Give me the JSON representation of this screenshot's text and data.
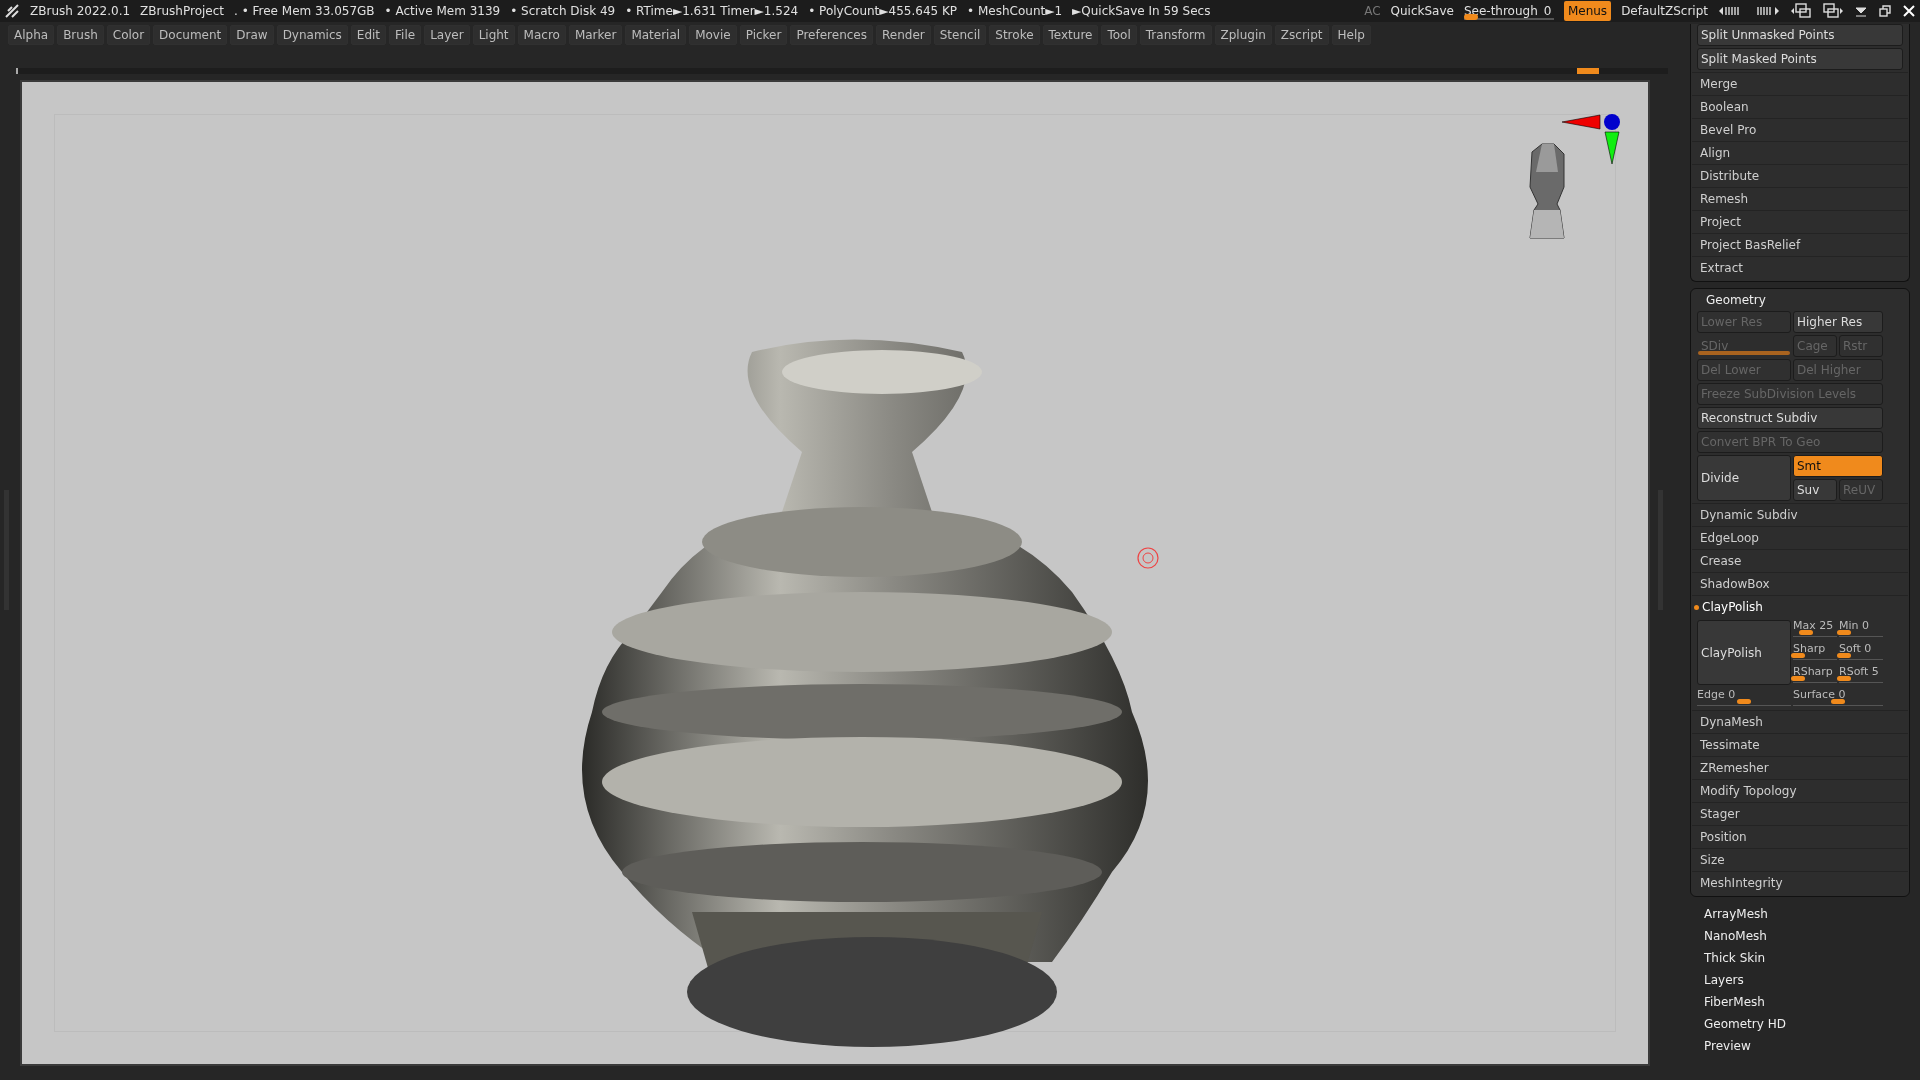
{
  "title_bar": {
    "app": "ZBrush 2022.0.1",
    "project": "ZBrushProject",
    "stats": [
      ". • Free Mem 33.057GB",
      "• Active Mem 3139",
      "• Scratch Disk 49",
      "•  RTime►1.631 Timer►1.524",
      "• PolyCount►455.645 KP",
      "• MeshCount►1"
    ],
    "quicksave_timer": "►QuickSave In 59 Secs",
    "ac": "AC",
    "quicksave": "QuickSave",
    "see_through": {
      "label": "See-through",
      "value": "0",
      "level": 0.08
    },
    "menus": {
      "label": "Menus",
      "on": true
    },
    "script": "DefaultZScript"
  },
  "menu": [
    "Alpha",
    "Brush",
    "Color",
    "Document",
    "Draw",
    "Dynamics",
    "Edit",
    "File",
    "Layer",
    "Light",
    "Macro",
    "Marker",
    "Material",
    "Movie",
    "Picker",
    "Preferences",
    "Render",
    "Stencil",
    "Stroke",
    "Texture",
    "Tool",
    "Transform",
    "Zplugin",
    "Zscript",
    "Help"
  ],
  "timeline": {
    "level": 0.945
  },
  "subtool_buttons": [
    "Split Unmasked Points",
    "Split Masked Points"
  ],
  "subtool_items": [
    "Merge",
    "Boolean",
    "Bevel Pro",
    "Align",
    "Distribute",
    "Remesh",
    "Project",
    "Project BasRelief",
    "Extract"
  ],
  "geometry": {
    "title": "Geometry",
    "grid": [
      {
        "kind": "pair",
        "cells": [
          {
            "label": "Lower Res",
            "disabled": true
          },
          {
            "label": "Higher Res",
            "disabled": false
          }
        ]
      },
      {
        "kind": "sdiv",
        "cells": [
          {
            "label": "SDiv",
            "disabled": true,
            "level": 1
          },
          {
            "label": "Cage",
            "disabled": true
          },
          {
            "label": "Rstr",
            "disabled": true
          }
        ]
      },
      {
        "kind": "pair",
        "cells": [
          {
            "label": "Del Lower",
            "disabled": true
          },
          {
            "label": "Del Higher",
            "disabled": true
          }
        ]
      },
      {
        "kind": "wide",
        "cells": [
          {
            "label": "Freeze SubDivision Levels",
            "disabled": true
          }
        ]
      },
      {
        "kind": "wide",
        "cells": [
          {
            "label": "Reconstruct Subdiv",
            "disabled": false
          }
        ]
      },
      {
        "kind": "wide",
        "cells": [
          {
            "label": "Convert BPR To Geo",
            "disabled": true
          }
        ]
      },
      {
        "kind": "divide",
        "cells": [
          {
            "label": "Divide",
            "disabled": false
          },
          {
            "label": "Smt",
            "disabled": false,
            "on": true
          },
          {
            "label": "Suv",
            "disabled": false,
            "on": false
          },
          {
            "label": "ReUV",
            "disabled": true,
            "on": false
          }
        ]
      }
    ],
    "items": [
      "Dynamic Subdiv",
      "EdgeLoop",
      "Crease",
      "ShadowBox"
    ],
    "claypolish": {
      "label": "ClayPolish",
      "active": true,
      "button": "ClayPolish",
      "sliders": [
        {
          "label": "Max",
          "value": "25",
          "level": 0.3
        },
        {
          "label": "Min",
          "value": "0",
          "level": 0.12
        },
        {
          "label": "Sharp",
          "level": 0.12
        },
        {
          "label": "Soft",
          "value": "0",
          "level": 0.12
        },
        {
          "label": "RSharp",
          "level": 0.12
        },
        {
          "label": "RSoft",
          "value": "5",
          "level": 0.12
        }
      ],
      "wide_sliders": [
        {
          "label": "Edge",
          "value": "0",
          "level": 0.5
        },
        {
          "label": "Surface",
          "value": "0",
          "level": 0.5
        }
      ]
    },
    "items_after": [
      "DynaMesh",
      "Tessimate",
      "ZRemesher",
      "Modify Topology",
      "Stager",
      "Position",
      "Size",
      "MeshIntegrity"
    ]
  },
  "tool_items": [
    "ArrayMesh",
    "NanoMesh",
    "Thick Skin",
    "Layers",
    "FiberMesh",
    "Geometry HD",
    "Preview"
  ]
}
